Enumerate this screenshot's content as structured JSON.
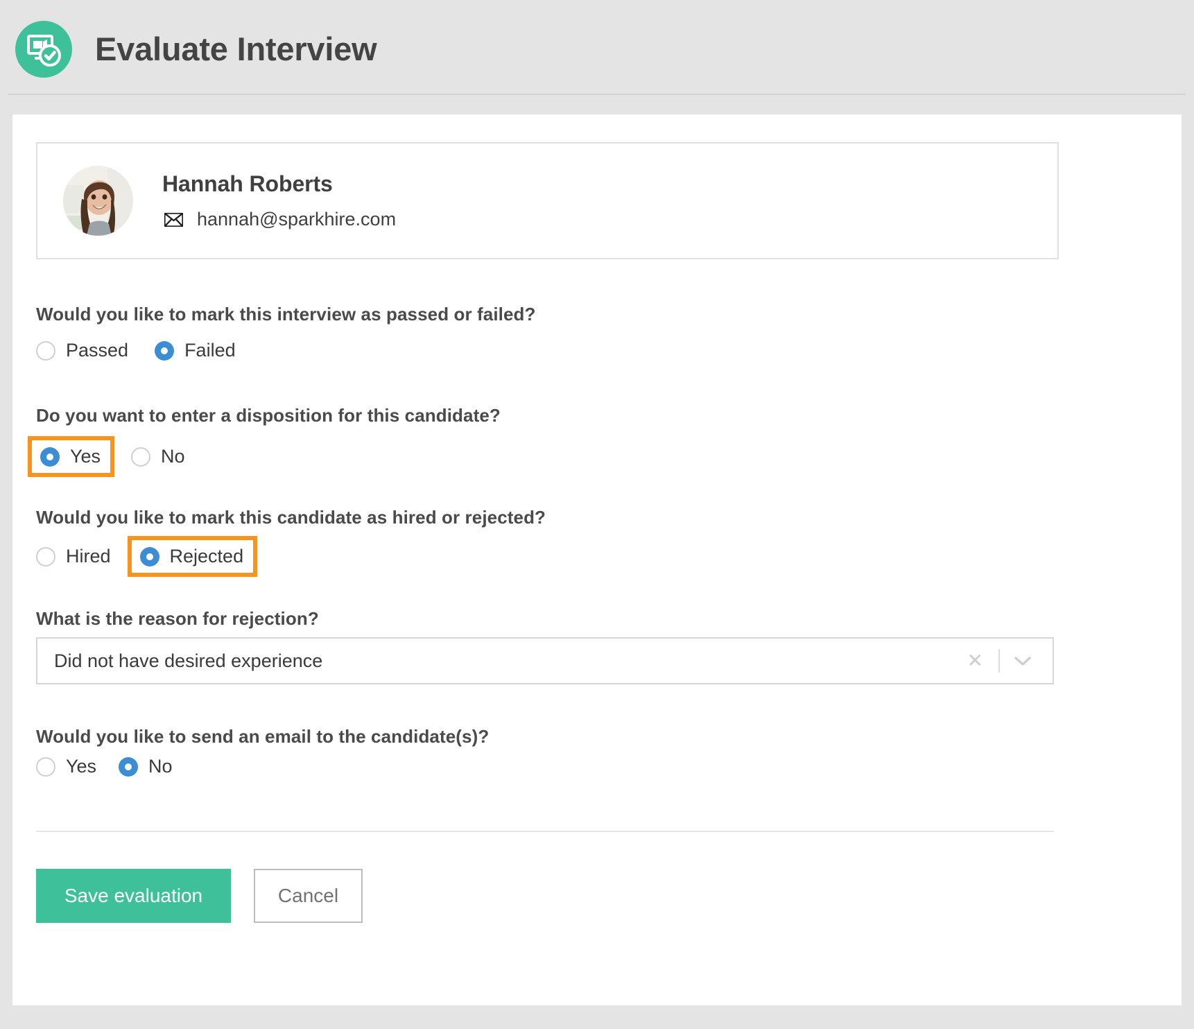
{
  "header": {
    "title": "Evaluate Interview",
    "icon": "video-interview-check-icon",
    "accent_color": "#3ec19a"
  },
  "candidate": {
    "name": "Hannah Roberts",
    "email": "hannah@sparkhire.com",
    "mail_icon": "envelope-icon",
    "avatar": "candidate-photo"
  },
  "questions": {
    "pass_fail": {
      "label": "Would you like to mark this interview as passed or failed?",
      "options": [
        {
          "label": "Passed",
          "selected": false,
          "highlighted": false
        },
        {
          "label": "Failed",
          "selected": true,
          "highlighted": false
        }
      ]
    },
    "disposition": {
      "label": "Do you want to enter a disposition for this candidate?",
      "options": [
        {
          "label": "Yes",
          "selected": true,
          "highlighted": true
        },
        {
          "label": "No",
          "selected": false,
          "highlighted": false
        }
      ]
    },
    "hired_rejected": {
      "label": "Would you like to mark this candidate as hired or rejected?",
      "options": [
        {
          "label": "Hired",
          "selected": false,
          "highlighted": false
        },
        {
          "label": "Rejected",
          "selected": true,
          "highlighted": true
        }
      ]
    },
    "rejection_reason": {
      "label": "What is the reason for rejection?",
      "value": "Did not have desired experience",
      "clear_icon": "close-icon",
      "chevron_icon": "chevron-down-icon"
    },
    "send_email": {
      "label": "Would you like to send an email to the candidate(s)?",
      "options": [
        {
          "label": "Yes",
          "selected": false,
          "highlighted": false
        },
        {
          "label": "No",
          "selected": true,
          "highlighted": false
        }
      ]
    }
  },
  "footer": {
    "save_label": "Save evaluation",
    "cancel_label": "Cancel"
  },
  "colors": {
    "accent_green": "#3ec19a",
    "radio_blue": "#3b8dd4",
    "highlight_orange": "#f7941d",
    "page_background": "#e4e4e4"
  }
}
